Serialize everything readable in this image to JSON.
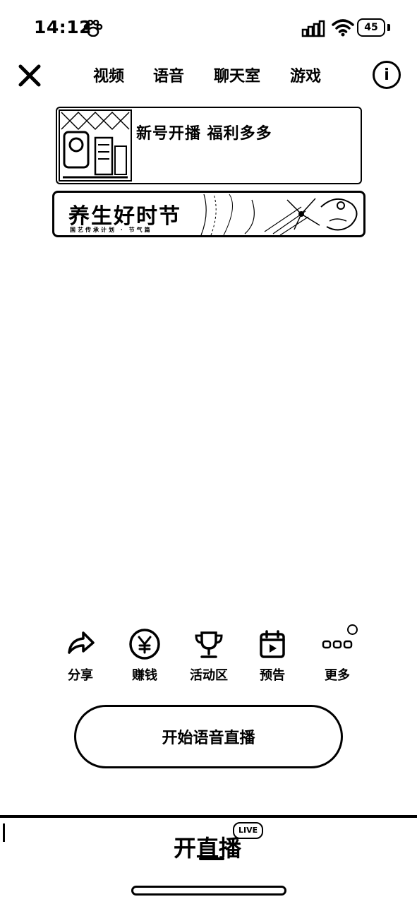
{
  "status_bar": {
    "time": "14:12",
    "battery": "45"
  },
  "topnav": {
    "tabs": [
      {
        "label": "视频"
      },
      {
        "label": "语音"
      },
      {
        "label": "聊天室"
      },
      {
        "label": "游戏"
      }
    ],
    "info_glyph": "ⓘ"
  },
  "banners": {
    "promo_new_streamer": {
      "title": "新号开播 福利多多"
    },
    "promo_health_festival": {
      "title": "养生好时节",
      "subtitle": "国艺传承计划 · 节气篇"
    }
  },
  "actions": [
    {
      "label": "分享",
      "icon": "share-icon"
    },
    {
      "label": "赚钱",
      "icon": "yen-coin-icon"
    },
    {
      "label": "活动区",
      "icon": "trophy-icon"
    },
    {
      "label": "预告",
      "icon": "calendar-play-icon"
    },
    {
      "label": "更多",
      "icon": "more-dots-icon"
    }
  ],
  "primary_button": {
    "label": "开始语音直播"
  },
  "bottom_tab": {
    "label": "开直播",
    "badge": "LIVE"
  },
  "colors": {
    "foreground": "#000000",
    "background": "#ffffff"
  }
}
